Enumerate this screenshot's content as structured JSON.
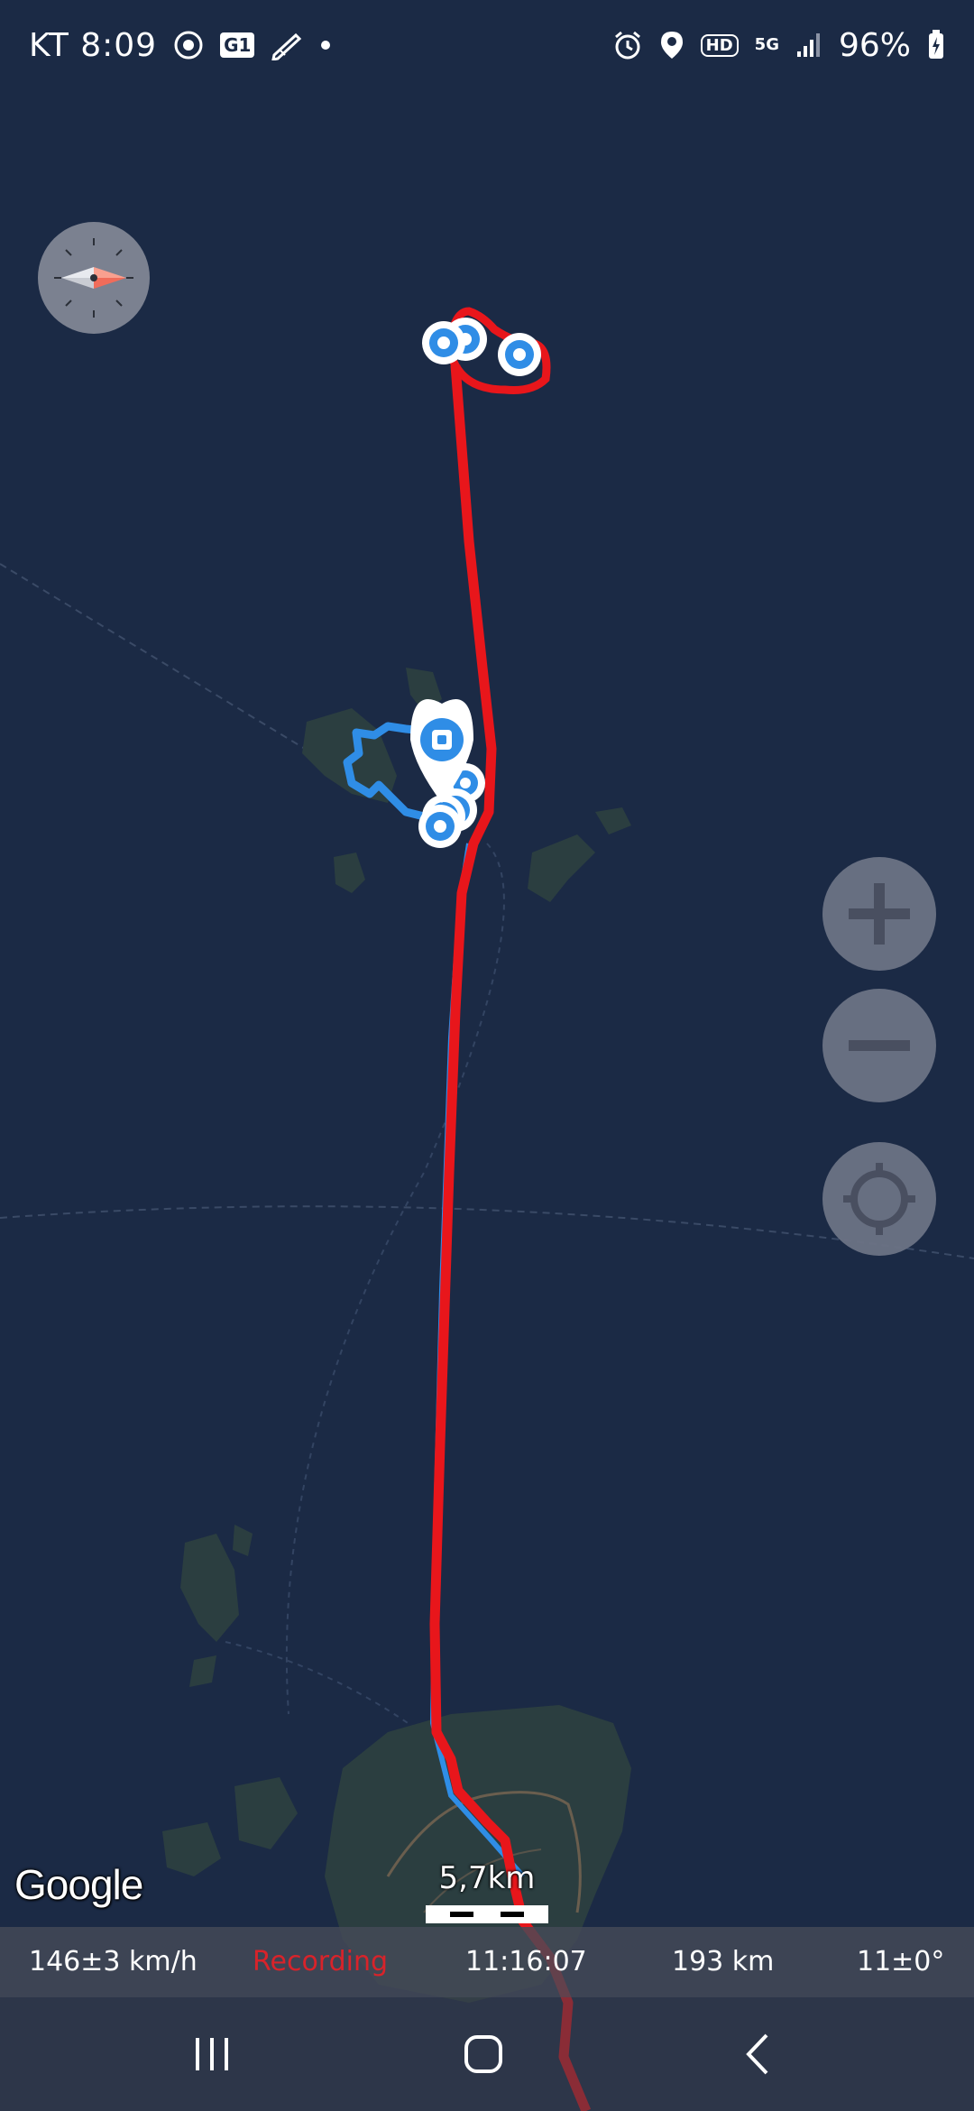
{
  "status_bar": {
    "carrier_time": "KT 8:09",
    "icons_left": [
      "target-icon",
      "app-badge-icon",
      "pen-icon",
      "dot-icon"
    ],
    "app_badge": "G1",
    "hd_label": "HD",
    "network": "5G",
    "battery": "96%"
  },
  "map": {
    "attribution": "Google",
    "scale_label": "5,7km",
    "track_colors": {
      "recorded": "#e8161b",
      "planned": "#2f8de6"
    }
  },
  "info_bar": {
    "speed": "146±3 km/h",
    "status": "Recording",
    "status_color": "#d8232a",
    "elapsed": "11:16:07",
    "distance": "193 km",
    "heading": "11±0°"
  },
  "controls": {
    "icons": [
      "zoom-in-icon",
      "zoom-out-icon",
      "my-location-icon"
    ]
  },
  "navigation": {
    "icons": [
      "recent-apps-icon",
      "home-icon",
      "back-icon"
    ]
  }
}
